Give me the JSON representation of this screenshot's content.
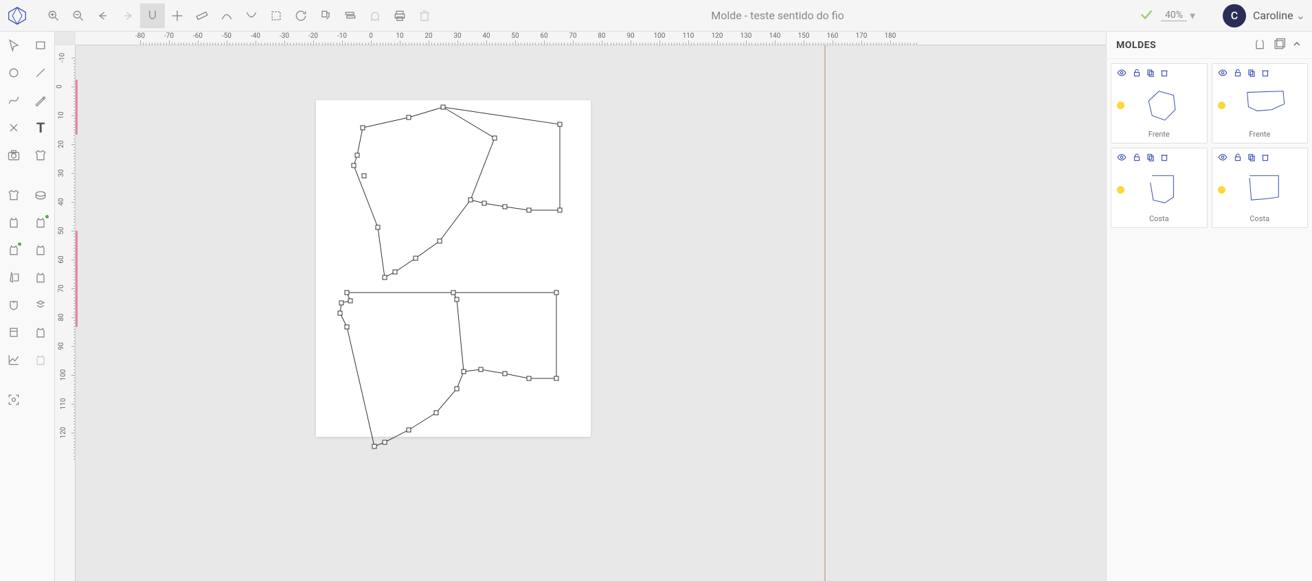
{
  "app": {
    "title": "Molde - teste sentido do fio",
    "zoom": "40%",
    "user_initial": "C",
    "user_name": "Caroline"
  },
  "topbar_tools": [
    "zoom-in",
    "zoom-out",
    "undo",
    "redo",
    "magnet",
    "crosshair",
    "ruler",
    "curve-1",
    "curve-2",
    "select-box",
    "refresh",
    "paint",
    "layers",
    "ghost",
    "print",
    "trash"
  ],
  "ruler_h": [
    -80,
    -70,
    -60,
    -50,
    -40,
    -30,
    -20,
    -10,
    0,
    10,
    20,
    30,
    40,
    50,
    60,
    70,
    80,
    90,
    100,
    110,
    120,
    130,
    140,
    150,
    160,
    170,
    180
  ],
  "ruler_v": [
    -10,
    0,
    10,
    20,
    30,
    40,
    50,
    60,
    70,
    80,
    90,
    100,
    110,
    120
  ],
  "panel": {
    "title": "MOLDES",
    "items": [
      {
        "label": "Frente"
      },
      {
        "label": "Frente"
      },
      {
        "label": "Costa"
      },
      {
        "label": "Costa"
      }
    ]
  }
}
